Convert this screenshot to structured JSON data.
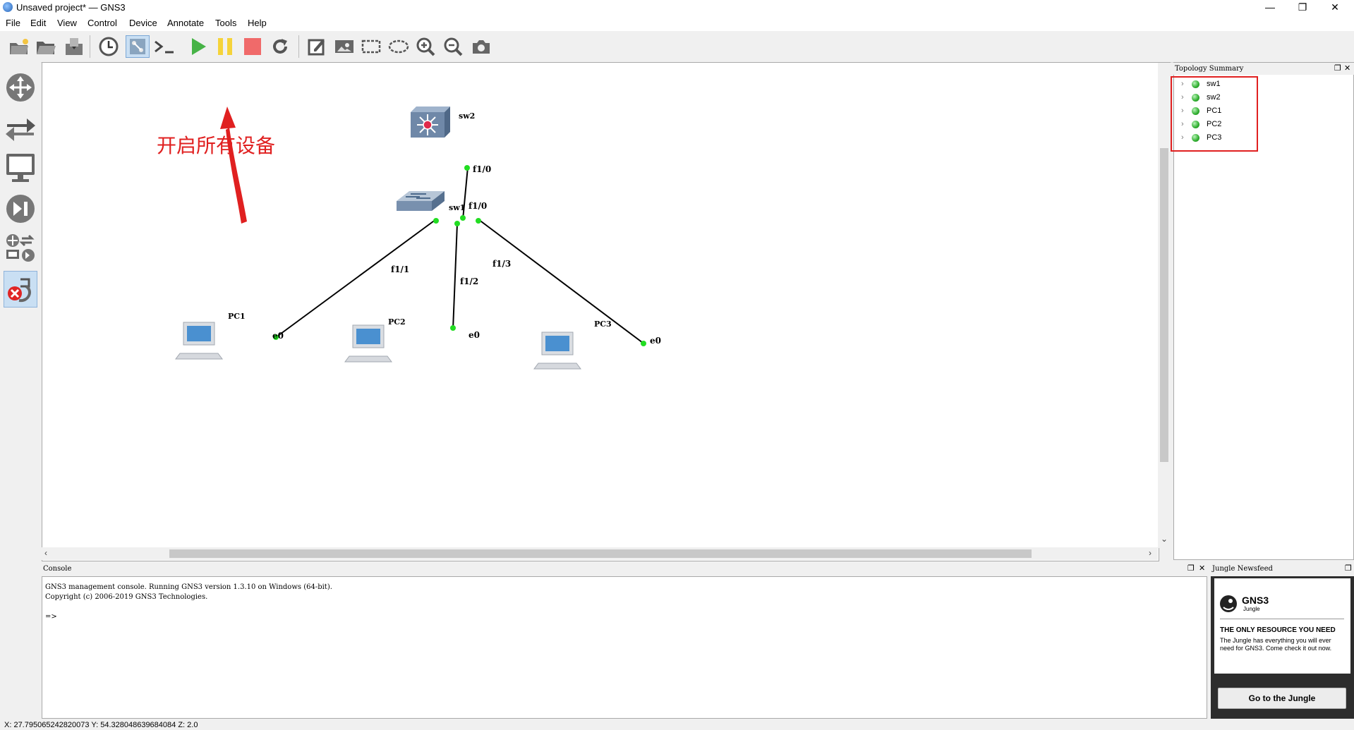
{
  "window": {
    "title": "Unsaved project* — GNS3",
    "controls": {
      "minimize": "—",
      "maximize": "❐",
      "close": "✕"
    }
  },
  "menu": [
    "File",
    "Edit",
    "View",
    "Control",
    "Device",
    "Annotate",
    "Tools",
    "Help"
  ],
  "toolbar": {
    "buttons": [
      "new-project",
      "open-project",
      "save-project",
      "snapshot-history",
      "show-interface-labels",
      "console-all",
      "start-all",
      "suspend-all",
      "stop-all",
      "reload-all",
      "add-note",
      "insert-picture",
      "draw-rectangle",
      "draw-ellipse",
      "zoom-in",
      "zoom-out",
      "screenshot"
    ],
    "colors": {
      "start": "#46b346",
      "suspend": "#f5d33a",
      "stop": "#f06a6a"
    }
  },
  "left_dock": [
    "routers",
    "switches",
    "end-devices",
    "security-devices",
    "all-devices",
    "add-link"
  ],
  "annotation": {
    "text": "开启所有设备",
    "color": "#e02020"
  },
  "topology": {
    "nodes": [
      {
        "id": "sw2",
        "label": "sw2",
        "type": "multilayer-switch"
      },
      {
        "id": "sw1",
        "label": "sw1",
        "type": "ethernet-switch"
      },
      {
        "id": "PC1",
        "label": "PC1",
        "type": "vpcs"
      },
      {
        "id": "PC2",
        "label": "PC2",
        "type": "vpcs"
      },
      {
        "id": "PC3",
        "label": "PC3",
        "type": "vpcs"
      }
    ],
    "ports": {
      "sw2_f10": "f1/0",
      "sw1_f10": "f1/0",
      "sw1_f11": "f1/1",
      "sw1_f12": "f1/2",
      "sw1_f13": "f1/3",
      "pc1_e0": "e0",
      "pc2_e0": "e0",
      "pc3_e0": "e0"
    },
    "port_color": "#22dd22"
  },
  "topology_summary": {
    "title": "Topology Summary",
    "items": [
      "sw1",
      "sw2",
      "PC1",
      "PC2",
      "PC3"
    ]
  },
  "console": {
    "title": "Console",
    "lines": [
      "GNS3 management console. Running GNS3 version 1.3.10 on Windows (64-bit).",
      "Copyright (c) 2006-2019 GNS3 Technologies.",
      "",
      "=>"
    ]
  },
  "jungle": {
    "title": "Jungle Newsfeed",
    "logo": "GNS3",
    "logo_sub": "Jungle",
    "heading": "THE ONLY RESOURCE YOU NEED",
    "body": "The Jungle has everything you will ever need for GNS3. Come check it out now.",
    "button": "Go to the Jungle"
  },
  "status": "X: 27.795065242820073 Y: 54.328048639684084 Z: 2.0"
}
